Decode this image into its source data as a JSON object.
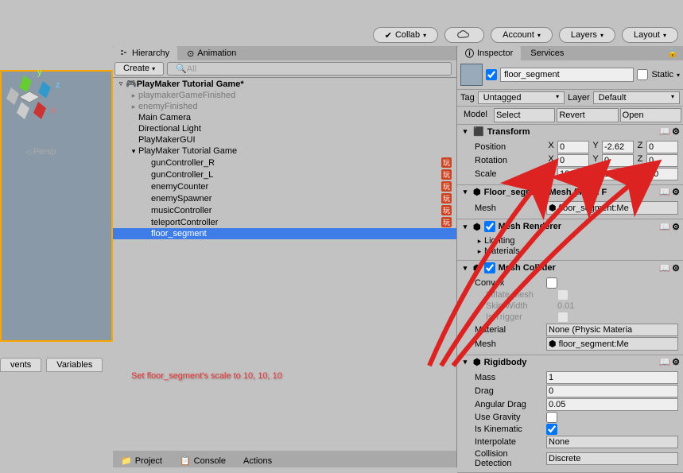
{
  "toolbar": {
    "collab": "Collab",
    "account": "Account",
    "layers": "Layers",
    "layout": "Layout"
  },
  "scene": {
    "persp": "Persp",
    "axes": {
      "x": "x",
      "y": "y",
      "z": "z"
    }
  },
  "left_tabs": {
    "events": "vents",
    "variables": "Variables"
  },
  "hierarchy": {
    "tab_label": "Hierarchy",
    "animation_tab": "Animation",
    "create": "Create",
    "all": "All",
    "root": "PlayMaker Tutorial Game*",
    "items": [
      {
        "label": "playmakerGameFinished",
        "gray": true,
        "indent": 1,
        "fold": "▸"
      },
      {
        "label": "enemyFinished",
        "gray": true,
        "indent": 1,
        "fold": "▸"
      },
      {
        "label": "Main Camera",
        "indent": 1
      },
      {
        "label": "Directional Light",
        "indent": 1
      },
      {
        "label": "PlayMakerGUI",
        "indent": 1
      },
      {
        "label": "PlayMaker Tutorial Game",
        "indent": 1,
        "fold": "▾"
      },
      {
        "label": "gunController_R",
        "indent": 2,
        "pm": true
      },
      {
        "label": "gunController_L",
        "indent": 2,
        "pm": true
      },
      {
        "label": "enemyCounter",
        "indent": 2,
        "pm": true
      },
      {
        "label": "enemySpawner",
        "indent": 2,
        "pm": true
      },
      {
        "label": "musicController",
        "indent": 2,
        "pm": true
      },
      {
        "label": "teleportController",
        "indent": 2,
        "pm": true
      },
      {
        "label": "floor_segment",
        "indent": 2,
        "selected": true
      }
    ],
    "project": "Project",
    "console": "Console",
    "actions": "Actions"
  },
  "inspector": {
    "tab": "Inspector",
    "services_tab": "Services",
    "name": "floor_segment",
    "static": "Static",
    "tag": "Tag",
    "tag_value": "Untagged",
    "layer": "Layer",
    "layer_value": "Default",
    "model": "Model",
    "select": "Select",
    "revert": "Revert",
    "open": "Open",
    "transform": {
      "title": "Transform",
      "position": "Position",
      "rotation": "Rotation",
      "scale": "Scale",
      "pos": {
        "x": "0",
        "y": "-2.62",
        "z": "0"
      },
      "rot": {
        "x": "0",
        "y": "0",
        "z": "0"
      },
      "scl": {
        "x": "10",
        "y": "10",
        "z": "10"
      }
    },
    "mesh_filter": {
      "title": "Floor_segment Mesh (Mesh F",
      "mesh": "Mesh",
      "mesh_value": "floor_segment:Me"
    },
    "mesh_renderer": {
      "title": "Mesh Renderer",
      "lighting": "Lighting",
      "materials": "Materials"
    },
    "mesh_collider": {
      "title": "Mesh Collider",
      "convex": "Convex",
      "inflate": "Inflate Mesh",
      "skin": "Skin Width",
      "skin_value": "0.01",
      "trigger": "Is Trigger",
      "material": "Material",
      "material_value": "None (Physic Materia",
      "mesh": "Mesh",
      "mesh_value": "floor_segment:Me"
    },
    "rigidbody": {
      "title": "Rigidbody",
      "mass": "Mass",
      "mass_value": "1",
      "drag": "Drag",
      "drag_value": "0",
      "angular_drag": "Angular Drag",
      "angular_drag_value": "0.05",
      "use_gravity": "Use Gravity",
      "is_kinematic": "Is Kinematic",
      "interpolate": "Interpolate",
      "interpolate_value": "None",
      "collision": "Collision Detection",
      "collision_value": "Discrete"
    }
  },
  "annotation": "Set floor_segment's scale to 10, 10, 10"
}
